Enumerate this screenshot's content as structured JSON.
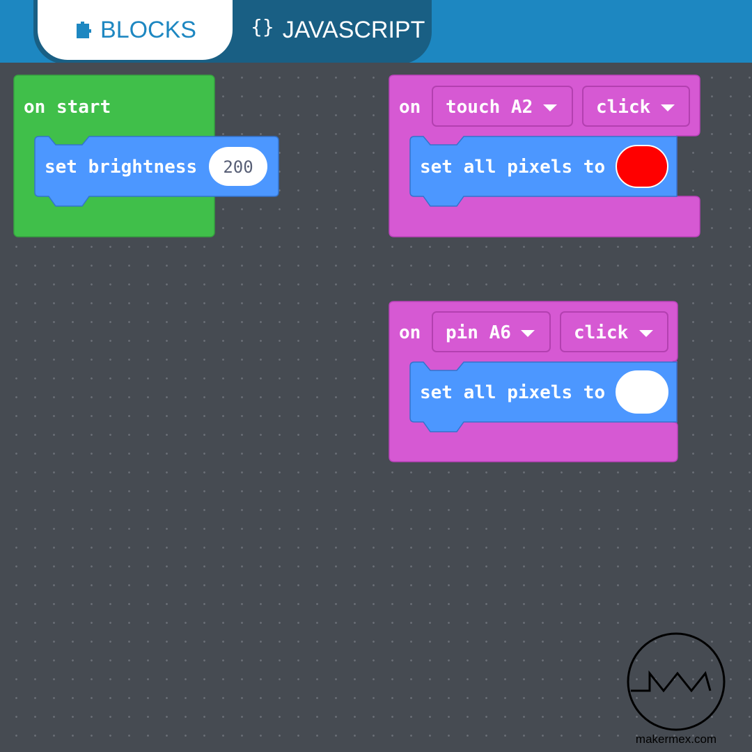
{
  "tabs": {
    "blocks_label": "BLOCKS",
    "javascript_label": "JAVASCRIPT",
    "javascript_icon": "{}"
  },
  "blocks": {
    "on_start": {
      "label": "on start",
      "child_label": "set brightness",
      "brightness_value": "200"
    },
    "touch_event": {
      "on_label": "on",
      "pin_label": "touch A2",
      "event_label": "click",
      "child_label": "set all pixels to",
      "color": "#ff0000"
    },
    "pin_event": {
      "on_label": "on",
      "pin_label": "pin A6",
      "event_label": "click",
      "child_label": "set all pixels to",
      "color": "#ffffff"
    }
  },
  "colors": {
    "loops_green": "#40bf4a",
    "input_magenta": "#d659d3",
    "light_blue": "#4c97ff",
    "header_blue": "#1d87c1"
  },
  "watermark": {
    "logo_text": "makermex.com"
  }
}
